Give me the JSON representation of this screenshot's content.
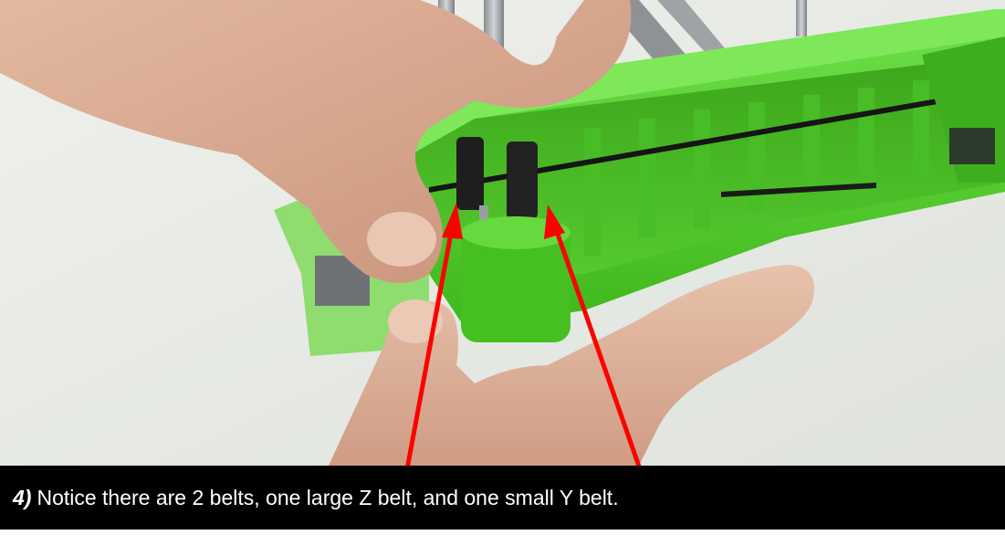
{
  "caption": {
    "step_number": "4)",
    "text": "Notice there are 2 belts, one large Z belt, and one small Y belt."
  },
  "colors": {
    "printer_body": "#4fcf2a",
    "caption_background": "#000000",
    "caption_text": "#ffffff",
    "arrow": "#ff0000"
  },
  "annotations": {
    "arrow_count": 2
  }
}
